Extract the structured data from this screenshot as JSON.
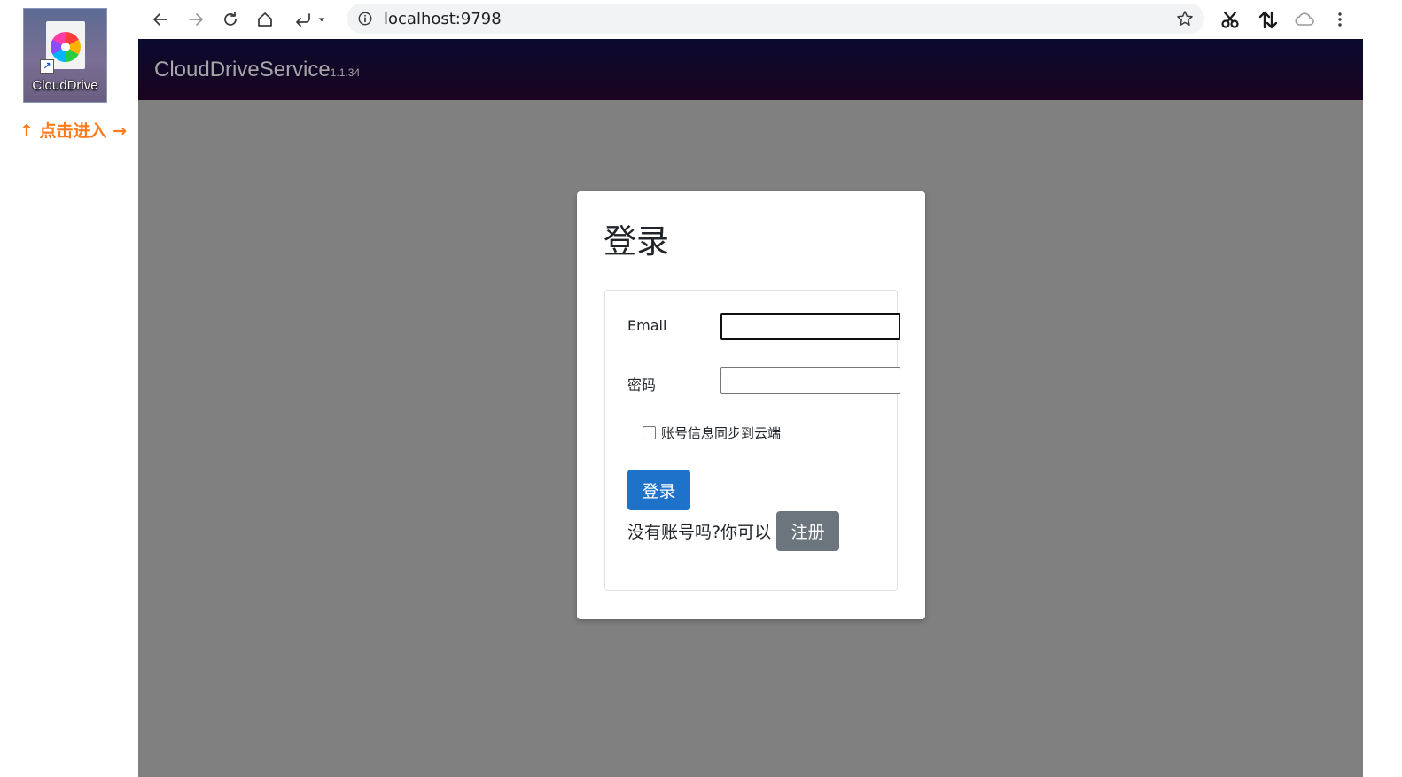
{
  "desktop": {
    "shortcut_label": "CloudDrive",
    "hint": "↑ 点击进入 →"
  },
  "browser": {
    "url": "localhost:9798",
    "icons": [
      "back-icon",
      "forward-icon",
      "reload-icon",
      "home-icon",
      "undo-icon",
      "dropdown-icon",
      "info-icon",
      "bookmark-star-icon",
      "scissors-icon",
      "sync-arrows-icon",
      "cloud-icon",
      "menu-icon"
    ]
  },
  "navbar": {
    "brand": "CloudDriveService",
    "version": "1.1.34"
  },
  "login": {
    "title": "登录",
    "email_label": "Email",
    "email_value": "",
    "password_label": "密码",
    "password_value": "",
    "remember_label": "账号信息同步到云端",
    "remember_checked": false,
    "login_button": "登录",
    "register_prompt": "没有账号吗?你可以",
    "register_button": "注册"
  },
  "colors": {
    "page_background": "#808080",
    "primary_button": "#1f72c9",
    "secondary_button": "#6c757d",
    "hint_text": "#ff7a1a"
  }
}
